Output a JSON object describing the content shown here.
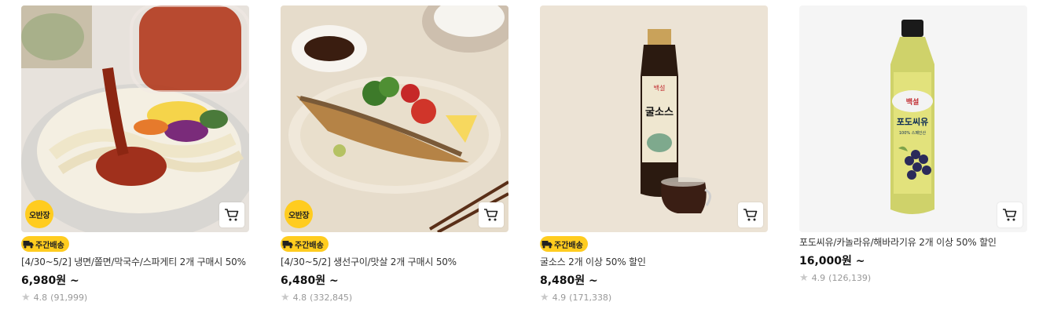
{
  "products": [
    {
      "badge": "오반장",
      "delivery": "주간배송",
      "title": "[4/30~5/2] 냉면/쫄면/막국수/스파게티 2개 구매시 50%",
      "price": "6,980원 ~",
      "rating": "4.8",
      "reviews": "(91,999)"
    },
    {
      "badge": "오반장",
      "delivery": "주간배송",
      "title": "[4/30~5/2] 생선구이/맛살 2개 구매시 50%",
      "price": "6,480원 ~",
      "rating": "4.8",
      "reviews": "(332,845)"
    },
    {
      "delivery": "주간배송",
      "title": "굴소스 2개 이상 50% 할인",
      "price": "8,480원 ~",
      "rating": "4.9",
      "reviews": "(171,338)",
      "bottle_label": "굴소스",
      "brand": "백설"
    },
    {
      "title": "포도씨유/카놀라유/해바라기유 2개 이상 50% 할인",
      "price": "16,000원 ~",
      "rating": "4.9",
      "reviews": "(126,139)",
      "bottle_label": "포도씨유",
      "brand": "백설",
      "bottle_sub": "100% 스페인산"
    }
  ],
  "icons": {
    "cart": "cart-icon",
    "star": "star-icon",
    "truck": "truck-icon"
  },
  "colors": {
    "badge_yellow": "#ffcc1f",
    "star_gray": "#c9c9c9"
  }
}
